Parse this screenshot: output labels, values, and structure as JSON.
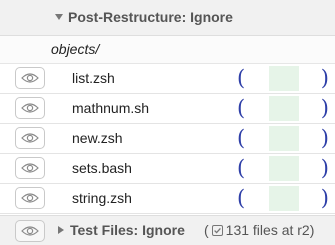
{
  "section": {
    "title": "Post-Restructure: Ignore",
    "expanded": true
  },
  "folder": {
    "name": "objects/"
  },
  "files": [
    {
      "name": "list.zsh"
    },
    {
      "name": "mathnum.sh"
    },
    {
      "name": "new.zsh"
    },
    {
      "name": "sets.bash"
    },
    {
      "name": "string.zsh"
    }
  ],
  "bracket": {
    "left": "(",
    "right": ")"
  },
  "footer": {
    "title": "Test Files: Ignore",
    "paren_open": "(",
    "info_text": "131 files at r2)"
  },
  "icons": {
    "visibility": "eye-icon",
    "collapse": "triangle-down-icon",
    "expand": "triangle-right-icon",
    "checkbox": "checkbox-checked-icon"
  },
  "colors": {
    "bracket": "#2e3fa8",
    "diff_green": "#e6f4e8",
    "header_bg": "#f1f1f1"
  }
}
